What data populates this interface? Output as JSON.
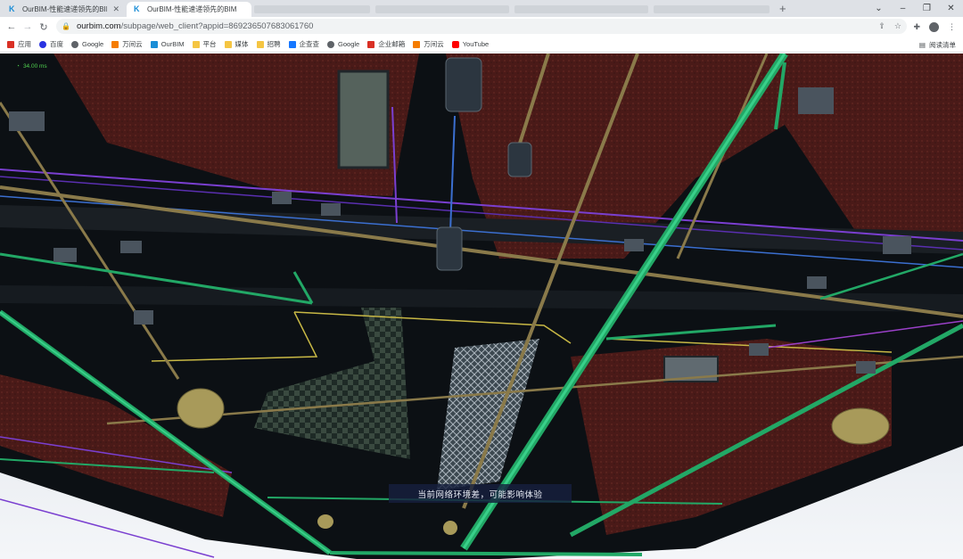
{
  "browser": {
    "tabs": [
      {
        "title": "OurBIM-性能速递领先的BIM引...",
        "active": false
      },
      {
        "title": "OurBIM-性能速递领先的BIM",
        "active": true
      }
    ],
    "new_tab_glyph": "+",
    "window_controls": [
      "⌄",
      "–",
      "❐",
      "✕"
    ]
  },
  "address_bar": {
    "host": "ourbim.com",
    "path": "/subpage/web_client?appid=869236507683061760",
    "icons": [
      "share-icon",
      "star-icon"
    ]
  },
  "bookmarks": [
    {
      "label": "应用",
      "icon": "apps-grid-icon",
      "color": "#d93025"
    },
    {
      "label": "百度",
      "icon": "baidu-icon",
      "color": "#2932e1"
    },
    {
      "label": "Google",
      "icon": "google-icon",
      "color": "#5f6368"
    },
    {
      "label": "万间云",
      "icon": "wanjianyun-icon",
      "color": "#f57c00"
    },
    {
      "label": "OurBIM",
      "icon": "ourbim-icon",
      "color": "#1a8dd6"
    },
    {
      "label": "平台",
      "icon": "folder-icon",
      "color": "#f5c542"
    },
    {
      "label": "媒体",
      "icon": "folder-icon",
      "color": "#f5c542"
    },
    {
      "label": "招聘",
      "icon": "folder-icon",
      "color": "#f5c542"
    },
    {
      "label": "企查查",
      "icon": "qichacha-icon",
      "color": "#1677ff"
    },
    {
      "label": "Google",
      "icon": "google-icon",
      "color": "#5f6368"
    },
    {
      "label": "企业邮箱",
      "icon": "mail-icon",
      "color": "#d93025"
    },
    {
      "label": "万间云",
      "icon": "wanjianyun-icon",
      "color": "#f57c00"
    },
    {
      "label": "YouTube",
      "icon": "youtube-icon",
      "color": "#ff0000"
    }
  ],
  "reading_list": "阅读清单",
  "viewport": {
    "fps_label": "34.00 ms",
    "toast": "当前网络环境差，可能影响体验"
  }
}
